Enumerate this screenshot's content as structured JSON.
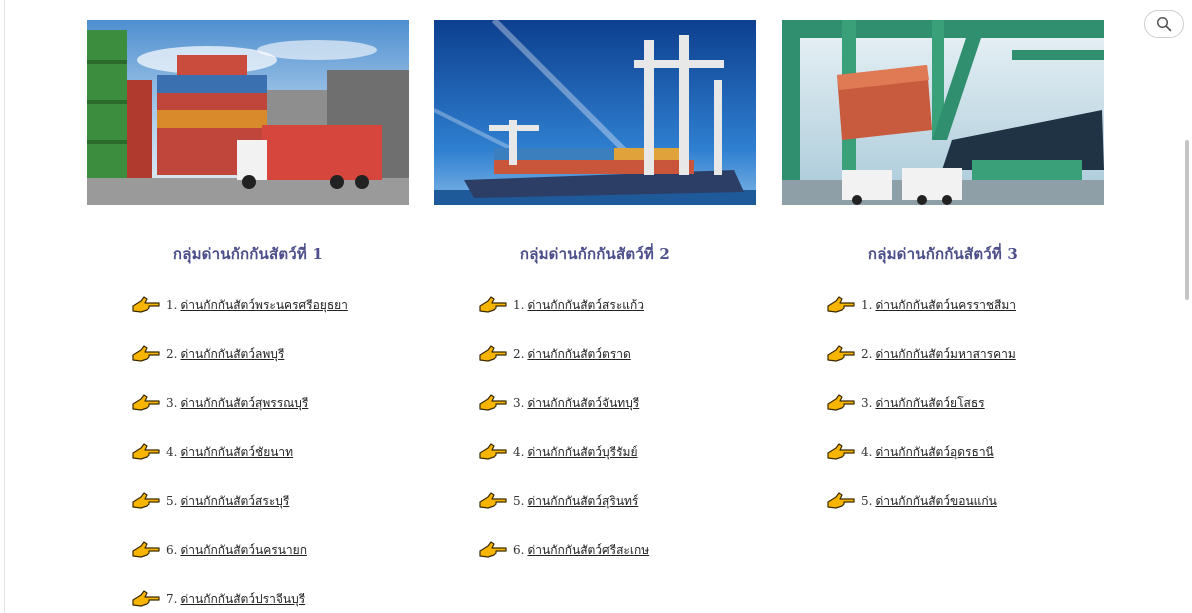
{
  "search": {
    "icon": "search-icon"
  },
  "columns": [
    {
      "title": "กลุ่มด่านกักกันสัตว์ที่ 1",
      "image": "container-yard-truck-photo",
      "links": [
        {
          "num": "1.",
          "label": "ด่านกักกันสัตว์พระนครศรีอยุธยา"
        },
        {
          "num": "2.",
          "label": "ด่านกักกันสัตว์ลพบุรี"
        },
        {
          "num": "3.",
          "label": "ด่านกักกันสัตว์สุพรรณบุรี"
        },
        {
          "num": "4.",
          "label": "ด่านกักกันสัตว์ชัยนาท"
        },
        {
          "num": "5.",
          "label": "ด่านกักกันสัตว์สระบุรี"
        },
        {
          "num": "6.",
          "label": "ด่านกักกันสัตว์นครนายก"
        },
        {
          "num": "7.",
          "label": "ด่านกักกันสัตว์ปราจีนบุรี"
        }
      ]
    },
    {
      "title": "กลุ่มด่านกักกันสัตว์ที่ 2",
      "image": "cargo-ship-port-cranes-photo",
      "links": [
        {
          "num": "1.",
          "label": "ด่านกักกันสัตว์สระแก้ว"
        },
        {
          "num": "2.",
          "label": "ด่านกักกันสัตว์ตราด"
        },
        {
          "num": "3.",
          "label": "ด่านกักกันสัตว์จันทบุรี"
        },
        {
          "num": "4.",
          "label": "ด่านกักกันสัตว์บุรีรัมย์"
        },
        {
          "num": "5.",
          "label": "ด่านกักกันสัตว์สุรินทร์"
        },
        {
          "num": "6.",
          "label": "ด่านกักกันสัตว์ศรีสะเกษ"
        }
      ]
    },
    {
      "title": "กลุ่มด่านกักกันสัตว์ที่ 3",
      "image": "gantry-crane-loading-photo",
      "links": [
        {
          "num": "1.",
          "label": "ด่านกักกันสัตว์นครราชสีมา"
        },
        {
          "num": "2.",
          "label": "ด่านกักกันสัตว์มหาสารคาม"
        },
        {
          "num": "3.",
          "label": "ด่านกักกันสัตว์ยโสธร"
        },
        {
          "num": "4.",
          "label": "ด่านกักกันสัตว์อุดรธานี"
        },
        {
          "num": "5.",
          "label": "ด่านกักกันสัตว์ขอนแก่น"
        }
      ]
    }
  ],
  "colors": {
    "title": "#4c4f8a",
    "hand_fill": "#f7b500",
    "hand_stroke": "#3a2a00"
  }
}
